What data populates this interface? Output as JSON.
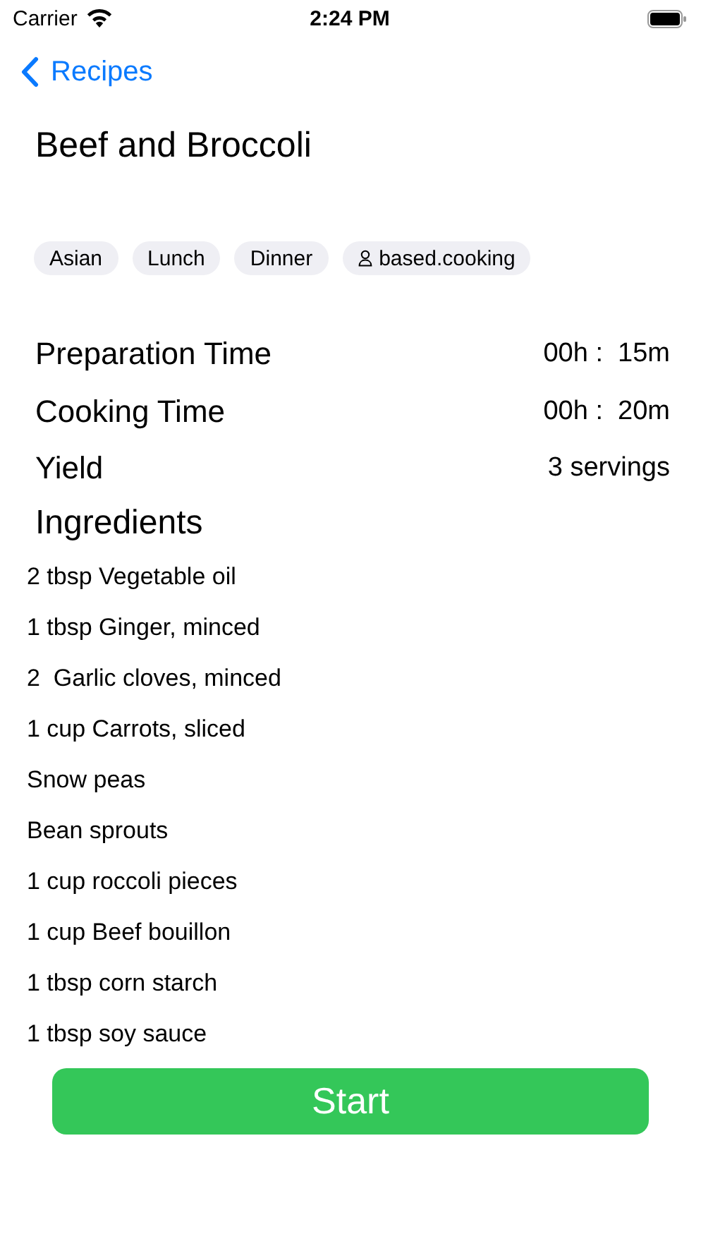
{
  "status_bar": {
    "carrier": "Carrier",
    "time": "2:24 PM"
  },
  "nav": {
    "back": "Recipes"
  },
  "title": "Beef and Broccoli",
  "tags": [
    {
      "kind": "tag",
      "label": "Asian"
    },
    {
      "kind": "tag",
      "label": "Lunch"
    },
    {
      "kind": "tag",
      "label": "Dinner"
    },
    {
      "kind": "source",
      "label": "based.cooking"
    }
  ],
  "details": [
    {
      "label": "Preparation Time",
      "value": "00h :  15m"
    },
    {
      "label": "Cooking Time",
      "value": "00h :  20m"
    },
    {
      "label": "Yield",
      "value": "3 servings"
    }
  ],
  "ingredients_heading": "Ingredients",
  "ingredients": [
    "2 tbsp Vegetable oil",
    "1 tbsp Ginger, minced",
    "2  Garlic cloves, minced",
    "1 cup Carrots, sliced",
    "Snow peas",
    "Bean sprouts",
    "1 cup roccoli pieces",
    "1 cup Beef bouillon",
    "1 tbsp corn starch",
    "1 tbsp soy sauce"
  ],
  "start_button": "Start"
}
